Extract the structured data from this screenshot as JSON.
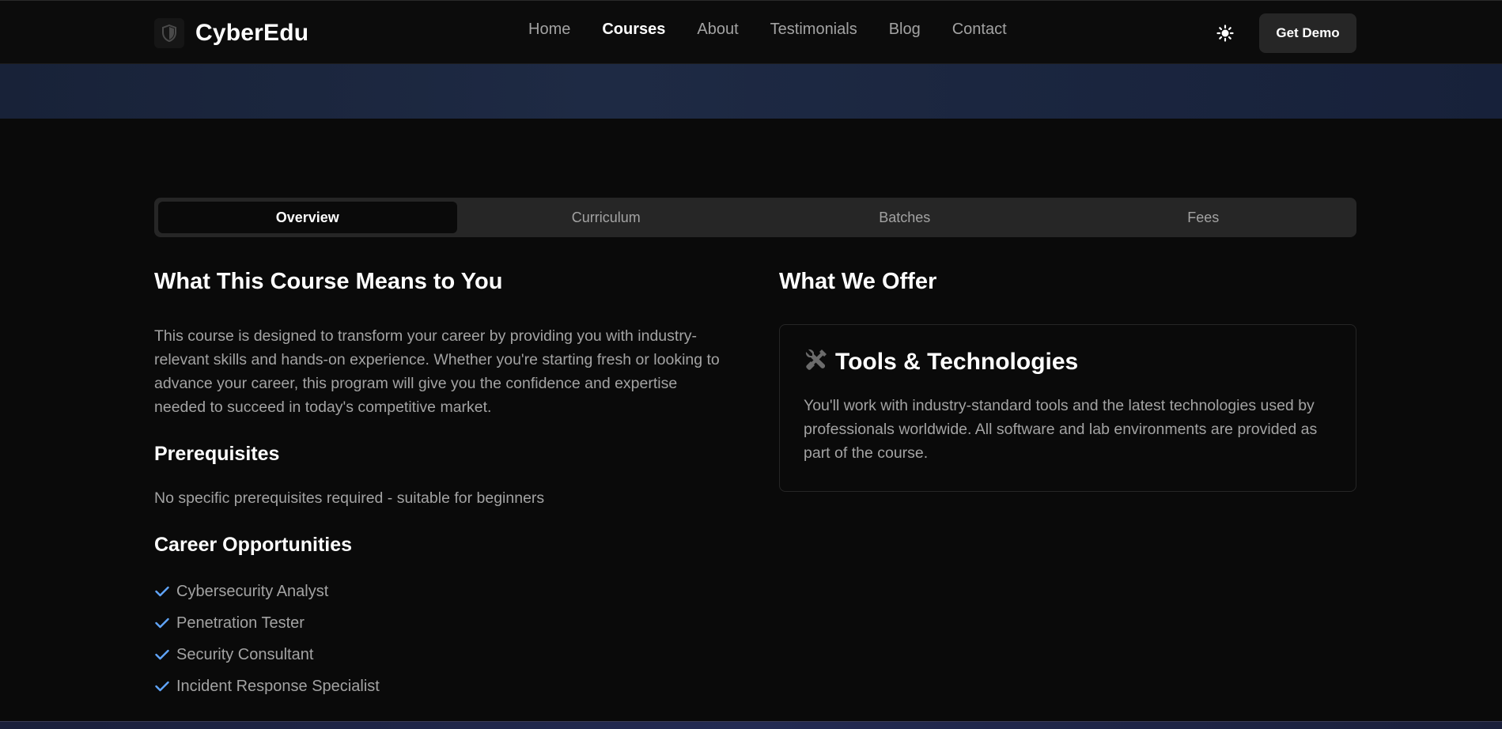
{
  "navbar": {
    "brand": "CyberEdu",
    "links": [
      {
        "label": "Home",
        "active": false
      },
      {
        "label": "Courses",
        "active": true
      },
      {
        "label": "About",
        "active": false
      },
      {
        "label": "Testimonials",
        "active": false
      },
      {
        "label": "Blog",
        "active": false
      },
      {
        "label": "Contact",
        "active": false
      }
    ],
    "theme_icon": "sun-icon",
    "demo_label": "Get Demo"
  },
  "tabs": [
    {
      "label": "Overview",
      "active": true
    },
    {
      "label": "Curriculum",
      "active": false
    },
    {
      "label": "Batches",
      "active": false
    },
    {
      "label": "Fees",
      "active": false
    }
  ],
  "overview": {
    "heading": "What This Course Means to You",
    "intro": "This course is designed to transform your career by providing you with industry-relevant skills and hands-on experience. Whether you're starting fresh or looking to advance your career, this program will give you the confidence and expertise needed to succeed in today's competitive market.",
    "prerequisites_heading": "Prerequisites",
    "prerequisites_text": "No specific prerequisites required - suitable for beginners",
    "career_heading": "Career Opportunities",
    "careers": [
      "Cybersecurity Analyst",
      "Penetration Tester",
      "Security Consultant",
      "Incident Response Specialist"
    ]
  },
  "offer": {
    "heading": "What We Offer",
    "card_icon": "tools-icon",
    "card_title": "Tools & Technologies",
    "card_text": "You'll work with industry-standard tools and the latest technologies used by professionals worldwide. All software and lab environments are provided as part of the course."
  },
  "colors": {
    "background": "#0a0a0a",
    "accent_check": "#60a5fa",
    "muted_text": "#a3a3a3",
    "button_bg": "#262626"
  }
}
